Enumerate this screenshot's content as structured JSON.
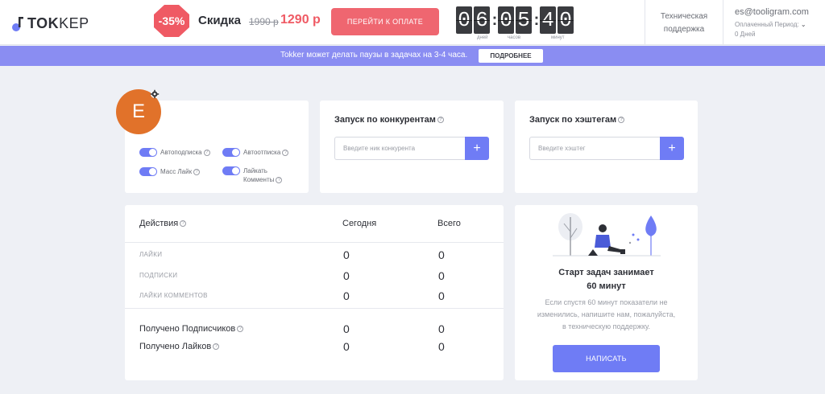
{
  "header": {
    "logo_bold": "TOK",
    "logo_thin": "KEP",
    "discount_badge": "-35%",
    "sale_label": "Скидка",
    "old_price": "1990 р",
    "new_price": "1290 р",
    "pay_button": "ПЕРЕЙТИ К ОПЛАТЕ",
    "timer_digits": [
      "0",
      "6",
      "0",
      "5",
      "4",
      "0"
    ],
    "timer_labels": [
      "дней",
      "часов",
      "минут"
    ],
    "support_line1": "Техническая",
    "support_line2": "поддержка",
    "account_email": "es@tooligram.com",
    "paid_period_label": "Оплаченный Период:",
    "paid_period_value": "0 Дней"
  },
  "notice": {
    "text": "Tokker может делать паузы в задачах на 3-4 часа.",
    "button": "ПОДРОБНЕЕ"
  },
  "profile": {
    "avatar_letter": "E",
    "toggles": [
      "Автоподписка",
      "Автоотписка",
      "Масс Лайк",
      "Лайкать Комменты"
    ]
  },
  "competitors": {
    "title": "Запуск по конкурентам",
    "placeholder": "Введите ник конкурента",
    "add": "+"
  },
  "hashtags": {
    "title": "Запуск по хэштегам",
    "placeholder": "Введите хэштег",
    "add": "+"
  },
  "stats": {
    "col_actions": "Действия",
    "col_today": "Сегодня",
    "col_total": "Всего",
    "rows": [
      {
        "label": "ЛАЙКИ",
        "today": "0",
        "total": "0"
      },
      {
        "label": "ПОДПИСКИ",
        "today": "0",
        "total": "0"
      },
      {
        "label": "ЛАЙКИ КОММЕНТОВ",
        "today": "0",
        "total": "0"
      }
    ],
    "received": [
      {
        "label": "Получено Подписчиков",
        "today": "0",
        "total": "0"
      },
      {
        "label": "Получено Лайков",
        "today": "0",
        "total": "0"
      }
    ]
  },
  "promo": {
    "title_line1": "Старт задач занимает",
    "title_line2": "60 минут",
    "text_line1": "Если спустя 60 минут показатели не",
    "text_line2": "изменились, напишите нам, пожалуйста,",
    "text_line3": "в техническую поддержку.",
    "button": "НАПИСАТЬ"
  },
  "colors": {
    "accent": "#6f7cf5",
    "sale": "#ef5a64",
    "avatar": "#e1722a",
    "notice": "#8a8df2"
  }
}
